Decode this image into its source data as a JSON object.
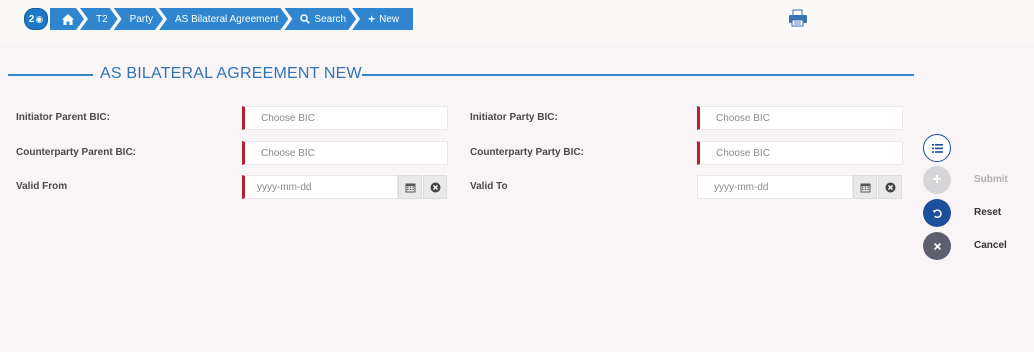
{
  "breadcrumb": {
    "badge_count": "2",
    "items": [
      "T2",
      "Party",
      "AS Bilateral Agreement",
      "Search",
      "New"
    ],
    "search_prefix": "Q",
    "new_prefix": "+"
  },
  "section": {
    "title": "AS BILATERAL AGREEMENT NEW"
  },
  "form": {
    "initiator_parent_bic": {
      "label": "Initiator Parent BIC:",
      "placeholder": "Choose BIC"
    },
    "initiator_party_bic": {
      "label": "Initiator Party BIC:",
      "placeholder": "Choose BIC"
    },
    "counterparty_parent_bic": {
      "label": "Counterparty Parent BIC:",
      "placeholder": "Choose BIC"
    },
    "counterparty_party_bic": {
      "label": "Counterparty Party BIC:",
      "placeholder": "Choose BIC"
    },
    "valid_from": {
      "label": "Valid From",
      "placeholder": "yyyy-mm-dd"
    },
    "valid_to": {
      "label": "Valid To",
      "placeholder": "yyyy-mm-dd"
    }
  },
  "actions": {
    "submit": "Submit",
    "reset": "Reset",
    "cancel": "Cancel"
  },
  "colors": {
    "accent": "#2f86cf",
    "required_marker": "#b3232f",
    "reset_button": "#1d4f9c",
    "cancel_button": "#5e5f6e"
  }
}
